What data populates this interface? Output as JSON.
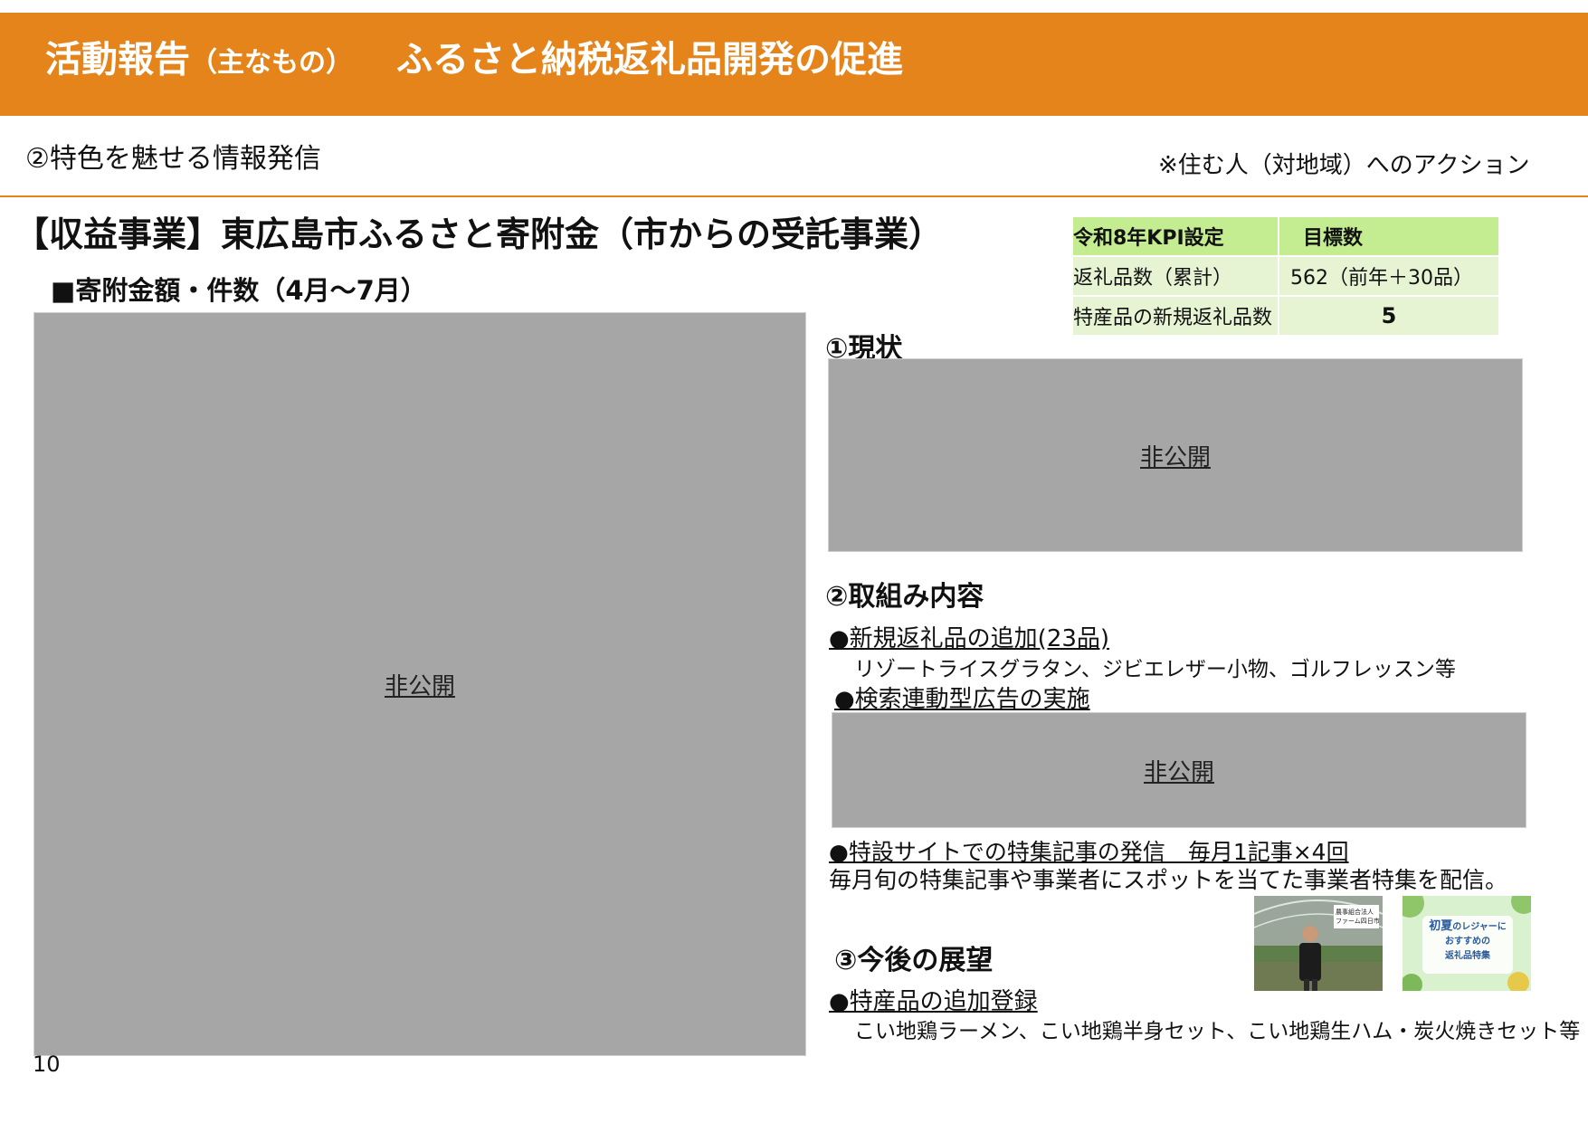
{
  "header": {
    "title_main": "活動報告",
    "title_sub": "（主なもの）",
    "title_topic": "ふるさと納税返礼品開発の促進"
  },
  "subtitle": "②特色を魅せる情報発信",
  "action_note": "※住む人（対地域）へのアクション",
  "section_heading": "【収益事業】東広島市ふるさと寄附金（市からの受託事業）",
  "chart_heading": "■寄附金額・件数（4月～7月）",
  "redacted_label": "非公開",
  "kpi": {
    "header_left": "令和8年KPI設定",
    "header_right": "目標数",
    "rows": [
      {
        "label": "返礼品数（累計）",
        "value": "562（前年＋30品）"
      },
      {
        "label": "特産品の新規返礼品数",
        "value": "5"
      }
    ]
  },
  "current_status": {
    "heading": "①現状"
  },
  "initiatives": {
    "heading": "②取組み内容",
    "item1_title": "●新規返礼品の追加(23品)",
    "item1_text": "リゾートライスグラタン、ジビエレザー小物、ゴルフレッスン等",
    "item2_title": "●検索連動型広告の実施",
    "item3_title": "●特設サイトでの特集記事の発信　毎月1記事×4回",
    "item3_text": "毎月旬の特集記事や事業者にスポットを当てた事業者特集を配信。"
  },
  "outlook": {
    "heading": "③今後の展望",
    "item1_title": "●特産品の追加登録",
    "item1_text": "こい地鶏ラーメン、こい地鶏半身セット、こい地鶏生ハム・炭火焼きセット等"
  },
  "thumb1": {
    "caption_line1": "農事組合法人",
    "caption_line2": "ファーム四日市"
  },
  "thumb2": {
    "line1a": "初夏",
    "line1b": "のレジャーに",
    "line2": "おすすめの",
    "line3": "返礼品特集"
  },
  "page_number": "10",
  "colors": {
    "header": "#e4841b",
    "kpi_header": "#c4ec91",
    "kpi_body": "#e6f4d4",
    "redacted": "#a6a6a6"
  }
}
